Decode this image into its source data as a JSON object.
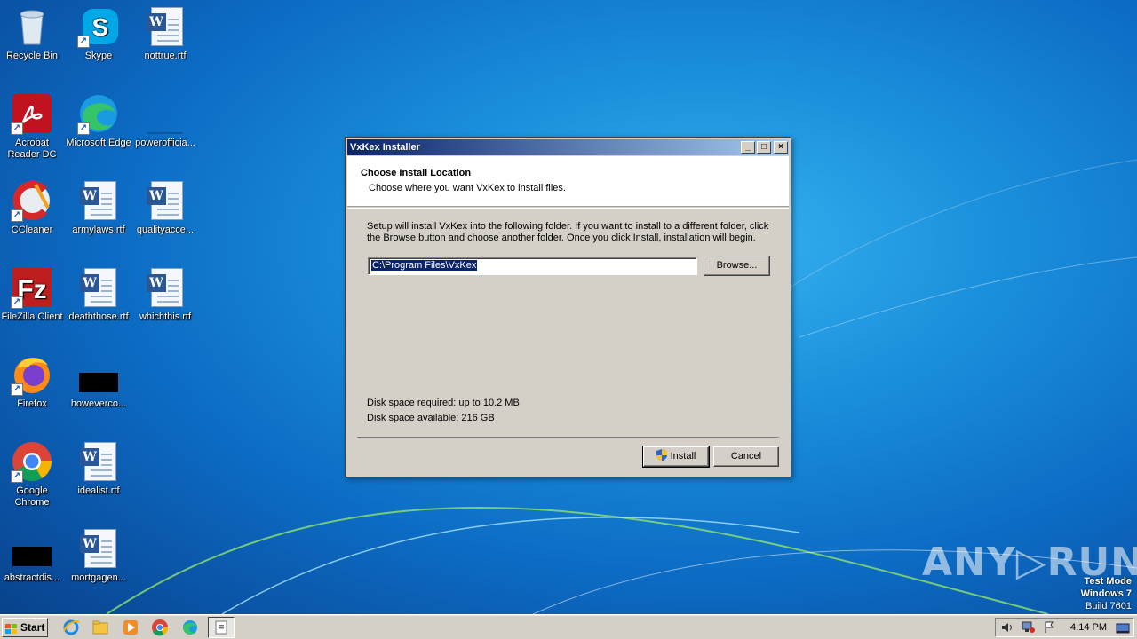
{
  "desktop": {
    "icons": [
      {
        "label": "Recycle Bin",
        "icon": "recycle-bin-icon"
      },
      {
        "label": "Skype",
        "icon": "skype-icon"
      },
      {
        "label": "nottrue.rtf",
        "icon": "word-document-icon"
      },
      {
        "label": "Acrobat Reader DC",
        "icon": "acrobat-icon"
      },
      {
        "label": "Microsoft Edge",
        "icon": "edge-icon"
      },
      {
        "label": "powerofficia...",
        "icon": "blank-file-icon"
      },
      {
        "label": "CCleaner",
        "icon": "ccleaner-icon"
      },
      {
        "label": "armylaws.rtf",
        "icon": "word-document-icon"
      },
      {
        "label": "qualityacce...",
        "icon": "word-document-icon"
      },
      {
        "label": "FileZilla Client",
        "icon": "filezilla-icon"
      },
      {
        "label": "deaththose.rtf",
        "icon": "word-document-icon"
      },
      {
        "label": "whichthis.rtf",
        "icon": "word-document-icon"
      },
      {
        "label": "Firefox",
        "icon": "firefox-icon"
      },
      {
        "label": "howeverco...",
        "icon": "black-file-icon"
      },
      {
        "label": "Google Chrome",
        "icon": "chrome-icon"
      },
      {
        "label": "idealist.rtf",
        "icon": "word-document-icon"
      },
      {
        "label": "abstractdis...",
        "icon": "black-file-icon"
      },
      {
        "label": "mortgagen...",
        "icon": "word-document-icon"
      }
    ]
  },
  "dialog": {
    "title": "VxKex Installer",
    "heading": "Choose Install Location",
    "subheading": "Choose where you want VxKex to install files.",
    "description": "Setup will install VxKex into the following folder. If you want to install to a different folder, click the Browse button and choose another folder. Once you click Install, installation will begin.",
    "path_value": "C:\\Program Files\\VxKex",
    "browse_label": "Browse...",
    "disk_required": "Disk space required: up to 10.2 MB",
    "disk_available": "Disk space available: 216 GB",
    "install_label": "Install",
    "cancel_label": "Cancel",
    "minimize_glyph": "_",
    "maximize_glyph": "□",
    "close_glyph": "×"
  },
  "taskbar": {
    "start_label": "Start",
    "clock": "4:14 PM"
  },
  "watermark": {
    "line1": "Test Mode",
    "line2": "Windows 7",
    "line3": "Build 7601",
    "brand": "ANY▷RUN"
  }
}
